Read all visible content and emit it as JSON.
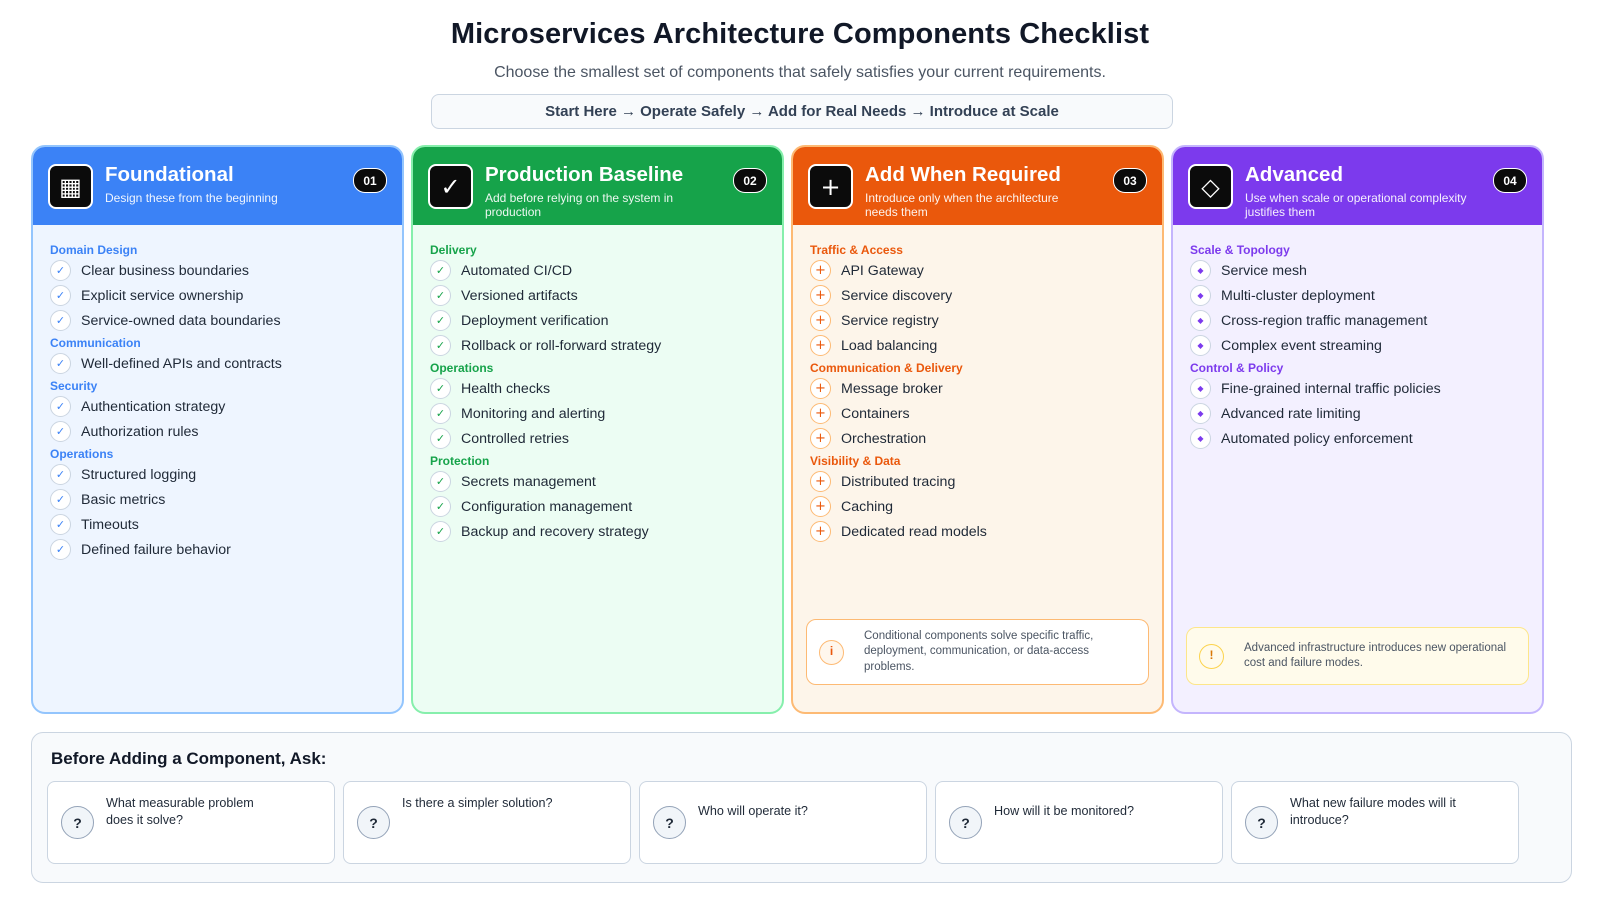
{
  "header": {
    "title": "Microservices Architecture Components Checklist",
    "subtitle": "Choose the smallest set of components that safely satisfies your current requirements.",
    "flow": "Start Here → Operate Safely → Add for Real Needs → Introduce at Scale"
  },
  "colors": {
    "blue": "#3b82f6",
    "green": "#16a34a",
    "orange": "#ea580c",
    "purple": "#7c3aed"
  },
  "cards": [
    {
      "title": "Foundational",
      "description": "Design these from the beginning",
      "badge": "01",
      "icon_name": "grid-icon",
      "icon_glyph": "▦",
      "groups": [
        {
          "title": "Domain Design",
          "items": [
            "Clear business boundaries",
            "Explicit service ownership",
            "Service-owned data boundaries"
          ]
        },
        {
          "title": "Communication",
          "items": [
            "Well-defined APIs and contracts"
          ]
        },
        {
          "title": "Security",
          "items": [
            "Authentication strategy",
            "Authorization rules"
          ]
        },
        {
          "title": "Operations",
          "items": [
            "Structured logging",
            "Basic metrics",
            "Timeouts",
            "Defined failure behavior"
          ]
        }
      ]
    },
    {
      "title": "Production Baseline",
      "description": "Add before relying on the system in production",
      "badge": "02",
      "icon_name": "check-icon",
      "icon_glyph": "✓",
      "groups": [
        {
          "title": "Delivery",
          "items": [
            "Automated CI/CD",
            "Versioned artifacts",
            "Deployment verification",
            "Rollback or roll-forward strategy"
          ]
        },
        {
          "title": "Operations",
          "items": [
            "Health checks",
            "Monitoring and alerting",
            "Controlled retries"
          ]
        },
        {
          "title": "Protection",
          "items": [
            "Secrets management",
            "Configuration management",
            "Backup and recovery strategy"
          ]
        }
      ]
    },
    {
      "title": "Add When Required",
      "description": "Introduce only when the architecture needs them",
      "badge": "03",
      "icon_name": "plus-icon",
      "icon_glyph": "+",
      "groups": [
        {
          "title": "Traffic & Access",
          "items": [
            "API Gateway",
            "Service discovery",
            "Service registry",
            "Load balancing"
          ]
        },
        {
          "title": "Communication & Delivery",
          "items": [
            "Message broker",
            "Containers",
            "Orchestration"
          ]
        },
        {
          "title": "Visibility & Data",
          "items": [
            "Distributed tracing",
            "Caching",
            "Dedicated read models"
          ]
        }
      ],
      "note": {
        "icon": "i",
        "icon_name": "info-icon",
        "text": "Conditional components solve specific traffic, deployment, communication, or data-access problems."
      }
    },
    {
      "title": "Advanced",
      "description": "Use when scale or operational complexity justifies them",
      "badge": "04",
      "icon_name": "diamond-icon",
      "icon_glyph": "◇",
      "groups": [
        {
          "title": "Scale & Topology",
          "items": [
            "Service mesh",
            "Multi-cluster deployment",
            "Cross-region traffic management",
            "Complex event streaming"
          ]
        },
        {
          "title": "Control & Policy",
          "items": [
            "Fine-grained internal traffic policies",
            "Advanced rate limiting",
            "Automated policy enforcement"
          ]
        }
      ],
      "note": {
        "icon": "!",
        "icon_name": "warning-icon",
        "text": "Advanced infrastructure introduces new operational cost and failure modes."
      }
    }
  ],
  "bottom": {
    "title": "Before Adding a Component, Ask:",
    "question_icon": "?",
    "questions": [
      "What measurable problem does it solve?",
      "Is there a simpler solution?",
      "Who will operate it?",
      "How will it be monitored?",
      "What new failure modes will it introduce?"
    ]
  }
}
